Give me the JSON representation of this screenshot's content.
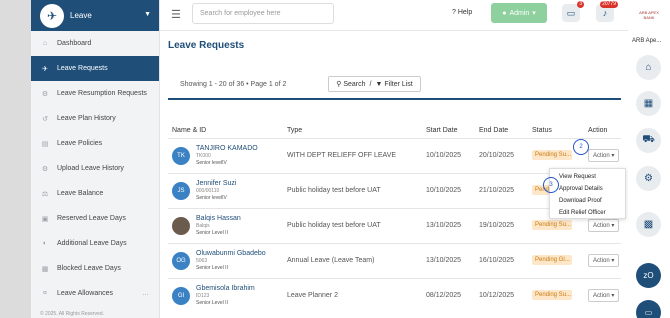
{
  "app": {
    "name": "Leave"
  },
  "sidebar": {
    "items": [
      {
        "label": "Dashboard",
        "icon": "home-icon"
      },
      {
        "label": "Leave Requests",
        "icon": "plane-icon"
      },
      {
        "label": "Leave Resumption Requests",
        "icon": "gear-icon"
      },
      {
        "label": "Leave Plan History",
        "icon": "history-icon"
      },
      {
        "label": "Leave Policies",
        "icon": "file-icon"
      },
      {
        "label": "Upload Leave History",
        "icon": "gear-icon"
      },
      {
        "label": "Leave Balance",
        "icon": "balance-icon"
      },
      {
        "label": "Reserved Leave Days",
        "icon": "lock-icon"
      },
      {
        "label": "Additional Leave Days",
        "icon": "shield-icon"
      },
      {
        "label": "Blocked Leave Days",
        "icon": "calendar-icon"
      },
      {
        "label": "Leave Allowances",
        "icon": "money-icon"
      }
    ],
    "footer": "© 2025. All Rights Reserved."
  },
  "header": {
    "search_placeholder": "Search for employee here",
    "help": "Help",
    "admin": "Admin",
    "notif_badge_1": "3",
    "notif_badge_2": "20779"
  },
  "main": {
    "title": "Leave Requests",
    "showing": "Showing  1 - 20 of 36 • Page 1 of 2",
    "search": "Search",
    "filter": "Filter List"
  },
  "table": {
    "headers": [
      "Name & ID",
      "Type",
      "Start Date",
      "End Date",
      "Status",
      "Action"
    ],
    "rows": [
      {
        "initials": "TK",
        "name": "TANJIRO KAMADO",
        "id": "TK000",
        "level": "Senior levelIV",
        "type": "WITH DEPT RELIEFF OFF LEAVE",
        "start": "10/10/2025",
        "end": "20/10/2025",
        "status": "Pending Su...",
        "action": "Action"
      },
      {
        "initials": "JS",
        "name": "Jennifer Suzi",
        "id": "000/00110",
        "level": "Senior levelIV",
        "type": "Public holiday test before UAT",
        "start": "10/10/2025",
        "end": "21/10/2025",
        "status": "Pend",
        "action": "Action"
      },
      {
        "initials": "",
        "name": "Balqis Hassan",
        "id": "Balqis",
        "level": "Senior Level II",
        "type": "Public holiday test before UAT",
        "start": "13/10/2025",
        "end": "19/10/2025",
        "status": "Pending Su...",
        "action": "Action"
      },
      {
        "initials": "OG",
        "name": "Oluwabunmi Gbadebo",
        "id": "5063",
        "level": "Senior Level II",
        "type": "Annual Leave (Leave Team)",
        "start": "13/10/2025",
        "end": "16/10/2025",
        "status": "Pending Gl...",
        "action": "Action"
      },
      {
        "initials": "GI",
        "name": "Gbemisola Ibrahim",
        "id": "ID123",
        "level": "Senior Level II",
        "type": "Leave Planner 2",
        "start": "08/12/2025",
        "end": "10/12/2025",
        "status": "Pending Su...",
        "action": "Action"
      }
    ]
  },
  "dropdown": {
    "items": [
      "View Request",
      "Approval Details",
      "Download Proof",
      "Edit Relief Officer"
    ]
  },
  "annotations": {
    "a2": "2",
    "a3": "3"
  },
  "rightbar": {
    "org_logo": "ARB APEX BANK",
    "org_name": "ARB Ape...",
    "user_initials": "zO"
  }
}
